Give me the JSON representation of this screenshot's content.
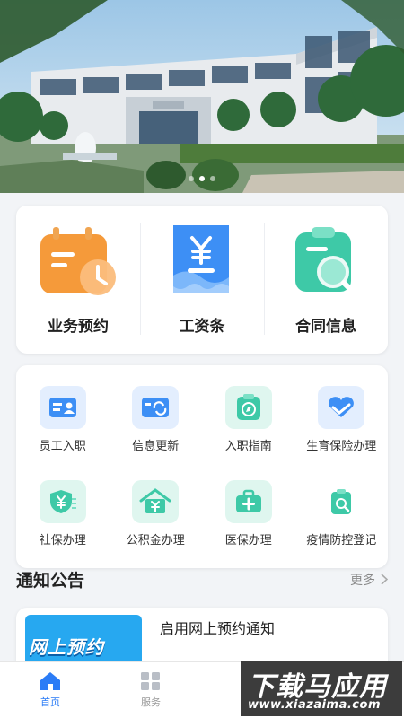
{
  "quick_actions": [
    {
      "label": "业务预约",
      "icon": "calendar-clock-icon"
    },
    {
      "label": "工资条",
      "icon": "salary-receipt-icon"
    },
    {
      "label": "合同信息",
      "icon": "clipboard-search-icon"
    }
  ],
  "services": [
    {
      "label": "员工入职",
      "icon": "id-card-icon"
    },
    {
      "label": "信息更新",
      "icon": "refresh-card-icon"
    },
    {
      "label": "入职指南",
      "icon": "compass-icon"
    },
    {
      "label": "生育保险办理",
      "icon": "heart-hand-icon"
    },
    {
      "label": "社保办理",
      "icon": "shield-yen-icon"
    },
    {
      "label": "公积金办理",
      "icon": "house-yen-icon"
    },
    {
      "label": "医保办理",
      "icon": "medical-kit-icon"
    },
    {
      "label": "疫情防控登记",
      "icon": "clipboard-search-icon"
    }
  ],
  "notice": {
    "title": "通知公告",
    "more": "更多",
    "items": [
      {
        "text": "启用网上预约通知",
        "thumb_text": "网上预约"
      }
    ]
  },
  "tabbar": [
    {
      "label": "首页",
      "active": true,
      "icon": "home-icon"
    },
    {
      "label": "服务",
      "active": false,
      "icon": "grid-icon"
    }
  ],
  "watermark": {
    "line1": "下载马应用",
    "line2": "www.xiazaima.com"
  },
  "colors": {
    "accent": "#2b7cf6",
    "orange": "#f59a3a",
    "blue": "#3d8ff5",
    "green": "#3ec9a7"
  }
}
